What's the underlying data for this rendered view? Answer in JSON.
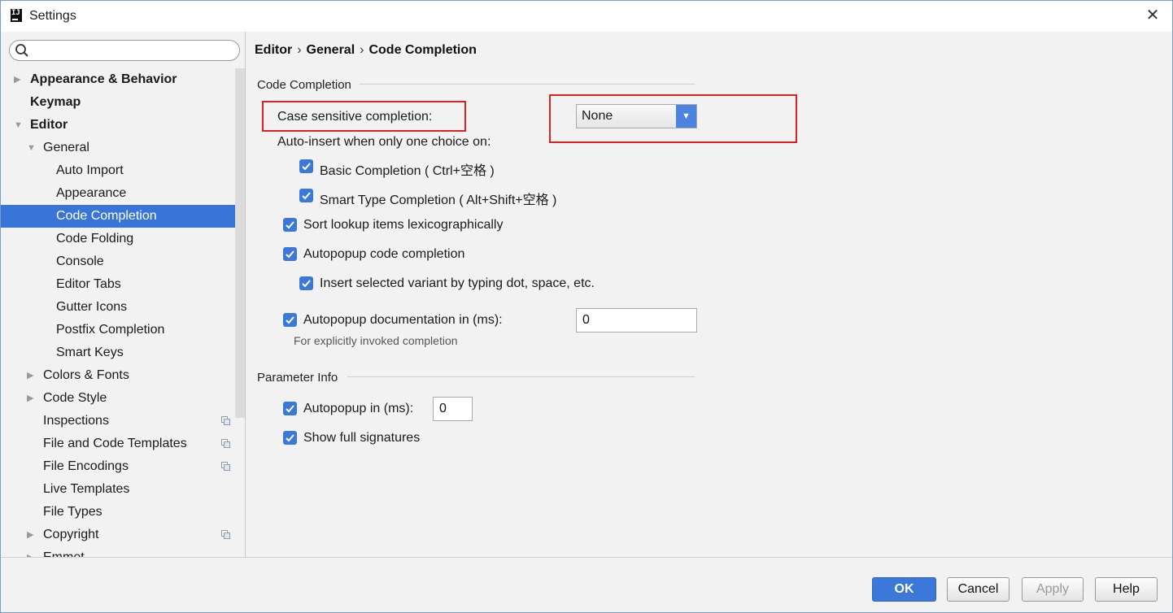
{
  "window": {
    "title": "Settings",
    "app_icon_text": "IJ"
  },
  "search": {
    "placeholder": "",
    "value": ""
  },
  "tree": [
    {
      "label": "Appearance & Behavior"
    },
    {
      "label": "Keymap"
    },
    {
      "label": "Editor"
    },
    {
      "label": "General"
    },
    {
      "label": "Auto Import"
    },
    {
      "label": "Appearance"
    },
    {
      "label": "Code Completion"
    },
    {
      "label": "Code Folding"
    },
    {
      "label": "Console"
    },
    {
      "label": "Editor Tabs"
    },
    {
      "label": "Gutter Icons"
    },
    {
      "label": "Postfix Completion"
    },
    {
      "label": "Smart Keys"
    },
    {
      "label": "Colors & Fonts"
    },
    {
      "label": "Code Style"
    },
    {
      "label": "Inspections"
    },
    {
      "label": "File and Code Templates"
    },
    {
      "label": "File Encodings"
    },
    {
      "label": "Live Templates"
    },
    {
      "label": "File Types"
    },
    {
      "label": "Copyright"
    },
    {
      "label": "Emmet"
    }
  ],
  "breadcrumb": {
    "part1": "Editor",
    "part2": "General",
    "part3": "Code Completion",
    "separator": "›"
  },
  "code_completion": {
    "section_title": "Code Completion",
    "case_sensitive_label": "Case sensitive completion:",
    "case_sensitive_value": "None",
    "auto_insert_label": "Auto-insert when only one choice on:",
    "basic_completion": "Basic Completion ( Ctrl+空格 )",
    "smart_type_completion": "Smart Type Completion ( Alt+Shift+空格 )",
    "sort_lookup": "Sort lookup items lexicographically",
    "autopopup_code": "Autopopup code completion",
    "insert_selected": "Insert selected variant by typing dot, space, etc.",
    "autopopup_doc": "Autopopup documentation in (ms):",
    "autopopup_doc_value": "0",
    "autopopup_doc_hint": "For explicitly invoked completion"
  },
  "parameter_info": {
    "section_title": "Parameter Info",
    "autopopup_label": "Autopopup in (ms):",
    "autopopup_value": "0",
    "show_full_signatures": "Show full signatures"
  },
  "buttons": {
    "ok": "OK",
    "cancel": "Cancel",
    "apply": "Apply",
    "help": "Help"
  },
  "colors": {
    "accent": "#3c78d8",
    "selection": "#3875d7",
    "highlight_red": "#e02020"
  }
}
